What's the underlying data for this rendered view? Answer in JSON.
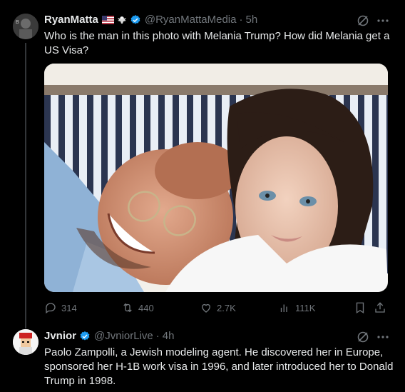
{
  "post": {
    "author_name": "RyanMatta",
    "author_handle": "@RyanMattaMedia",
    "separator": "·",
    "time": "5h",
    "text_line1": "Who is the man in this photo with Melania Trump? How did Melania get a",
    "text_line2": "US Visa?",
    "actions": {
      "replies": "314",
      "reposts": "440",
      "likes": "2.7K",
      "views": "111K"
    }
  },
  "reply": {
    "author_name": "Jvnior",
    "author_handle": "@JvniorLive",
    "separator": "·",
    "time": "4h",
    "text_lines": [
      "Paolo Zampolli, a Jewish modeling agent. He discovered her in Europe,",
      "sponsored her H-1B work visa in 1996, and later introduced her to Donald",
      "Trump in 1998."
    ]
  },
  "colors": {
    "background": "#000000",
    "text": "#e7e9ea",
    "muted": "#71767b",
    "verified": "#1d9bf0"
  },
  "icons": [
    "grok-icon",
    "more-icon",
    "reply-icon",
    "repost-icon",
    "like-icon",
    "views-icon",
    "bookmark-icon",
    "share-icon",
    "verified-icon",
    "us-flag-icon",
    "eagle-icon"
  ]
}
